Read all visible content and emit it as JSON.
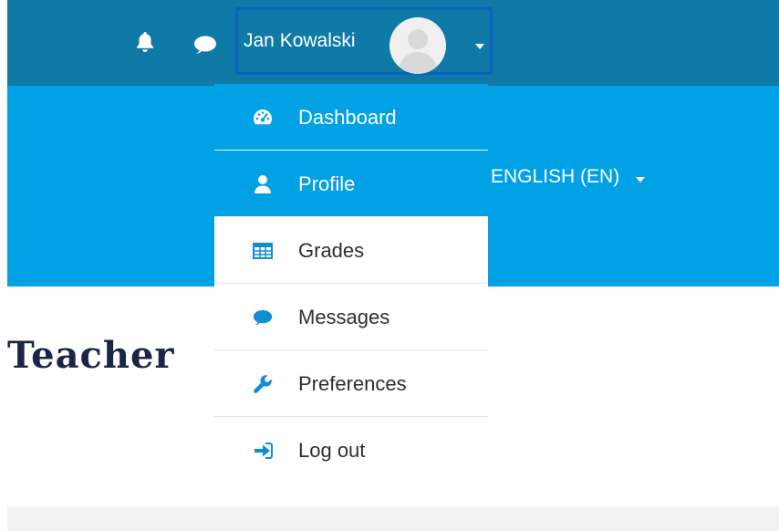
{
  "header": {
    "user_name": "Jan Kowalski",
    "language": "ENGLISH (EN)"
  },
  "page": {
    "title": "Teacher"
  },
  "user_menu": {
    "items": [
      {
        "label": "Dashboard",
        "icon": "dashboard-icon"
      },
      {
        "label": "Profile",
        "icon": "user-icon"
      },
      {
        "label": "Grades",
        "icon": "table-icon"
      },
      {
        "label": "Messages",
        "icon": "chat-bubble-icon"
      },
      {
        "label": "Preferences",
        "icon": "wrench-icon"
      },
      {
        "label": "Log out",
        "icon": "sign-out-icon"
      }
    ]
  },
  "colors": {
    "topbar": "#0f7aa6",
    "navbar": "#00a2e5",
    "menu_icon": "#0f8fd0",
    "title": "#1b2647"
  }
}
